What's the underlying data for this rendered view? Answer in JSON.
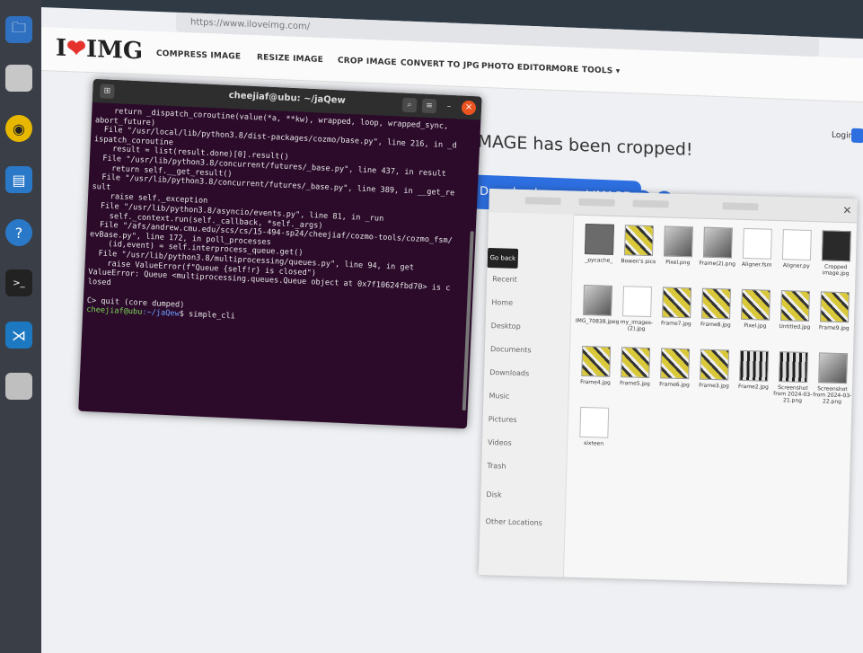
{
  "browser": {
    "url": "https://www.iloveimg.com/",
    "logo": {
      "prefix": "I",
      "heart": "❤",
      "suffix": "IMG"
    },
    "nav": [
      "COMPRESS IMAGE",
      "RESIZE IMAGE",
      "CROP IMAGE",
      "CONVERT TO JPG",
      "PHOTO EDITOR",
      "MORE TOOLS ▾"
    ],
    "message": "IMAGE has been cropped!",
    "download_label": "Download cropped IMAGE",
    "login": "Login"
  },
  "terminal": {
    "title": "cheejiaf@ubu: ~/jaQew",
    "lines": [
      "    return _dispatch_coroutine(value(*a, **kw), wrapped, loop, wrapped_sync,",
      "abort_future)",
      "  File \"/usr/local/lib/python3.8/dist-packages/cozmo/base.py\", line 216, in _d",
      "ispatch_coroutine",
      "    result = list(result.done)[0].result()",
      "  File \"/usr/lib/python3.8/concurrent/futures/_base.py\", line 437, in result",
      "    return self.__get_result()",
      "  File \"/usr/lib/python3.8/concurrent/futures/_base.py\", line 389, in __get_re",
      "sult",
      "    raise self._exception",
      "  File \"/usr/lib/python3.8/asyncio/events.py\", line 81, in _run",
      "    self._context.run(self._callback, *self._args)",
      "  File \"/afs/andrew.cmu.edu/scs/cs/15-494-sp24/cheejiaf/cozmo-tools/cozmo_fsm/",
      "evBase.py\", line 172, in poll_processes",
      "    (id,event) = self.interprocess_queue.get()",
      "  File \"/usr/lib/python3.8/multiprocessing/queues.py\", line 94, in get",
      "    raise ValueError(f\"Queue {self!r} is closed\")",
      "ValueError: Queue <multiprocessing.queues.Queue object at 0x7f10624fbd70> is c",
      "losed",
      "",
      "C> quit (core dumped)"
    ],
    "prompt_user": "cheejiaf@ubu",
    "prompt_path": ":~/jaQew",
    "prompt_cmd": "$ simple_cli"
  },
  "filemanager": {
    "sidebar": [
      "Recent",
      "Home",
      "Desktop",
      "Documents",
      "Downloads",
      "Music",
      "Pictures",
      "Videos",
      "Trash",
      "Disk",
      "Other Locations"
    ],
    "goback": "Go back",
    "files": [
      {
        "name": "_pycache_",
        "style": "folder"
      },
      {
        "name": "Bowen's pics",
        "style": "yellow"
      },
      {
        "name": "Pixel.png",
        "style": "mixed"
      },
      {
        "name": "Frame(2).png",
        "style": "mixed"
      },
      {
        "name": "Aligner.fsm",
        "style": "doc"
      },
      {
        "name": "Aligner.py",
        "style": "doc"
      },
      {
        "name": "Cropped image.jpg",
        "style": "dark"
      },
      {
        "name": "IMG_70838.jpeg",
        "style": "mixed"
      },
      {
        "name": "my_images-(2).jpg",
        "style": "doc"
      },
      {
        "name": "Frame7.jpg",
        "style": "yellow"
      },
      {
        "name": "Frame8.jpg",
        "style": "yellow"
      },
      {
        "name": "Pixel.jpg",
        "style": "yellow"
      },
      {
        "name": "Untitled.jpg",
        "style": "yellow"
      },
      {
        "name": "Frame9.jpg",
        "style": "yellow"
      },
      {
        "name": "Frame4.jpg",
        "style": "yellow"
      },
      {
        "name": "Frame5.jpg",
        "style": "yellow"
      },
      {
        "name": "Frame6.jpg",
        "style": "yellow"
      },
      {
        "name": "Frame3.jpg",
        "style": "yellow"
      },
      {
        "name": "Frame2.jpg",
        "style": "grid"
      },
      {
        "name": "Screenshot from 2024-03-21.png",
        "style": "grid"
      },
      {
        "name": "Screenshot from 2024-03-22.png",
        "style": "mixed"
      },
      {
        "name": "sixteen",
        "style": "doc"
      }
    ]
  },
  "dock": [
    "files-icon",
    "rhythmbox-icon",
    "document-icon",
    "help-icon",
    "terminal-icon",
    "vscode-icon",
    "trash-icon"
  ]
}
